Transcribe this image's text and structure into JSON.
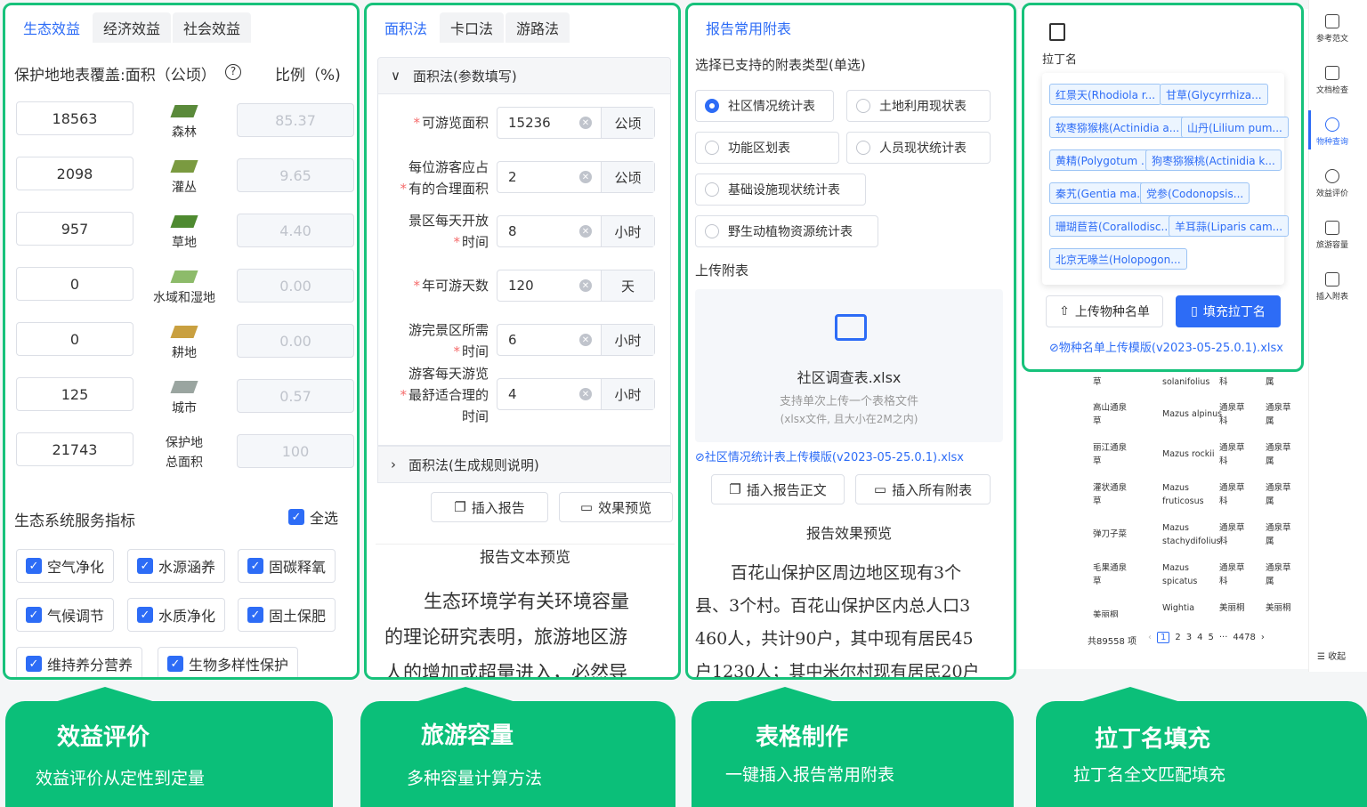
{
  "p1": {
    "tabs": [
      "生态效益",
      "经济效益",
      "社会效益"
    ],
    "header_label": "保护地地表覆盖:面积（公顷）",
    "ratio_label": "比例（%)",
    "rows": [
      {
        "area": "18563",
        "name": "森林",
        "ratio": "85.37"
      },
      {
        "area": "2098",
        "name": "灌丛",
        "ratio": "9.65"
      },
      {
        "area": "957",
        "name": "草地",
        "ratio": "4.40"
      },
      {
        "area": "0",
        "name": "水域和湿地",
        "ratio": "0.00"
      },
      {
        "area": "0",
        "name": "耕地",
        "ratio": "0.00"
      },
      {
        "area": "125",
        "name": "城市",
        "ratio": "0.57"
      }
    ],
    "total": {
      "area": "21743",
      "name_line1": "保护地",
      "name_line2": "总面积",
      "ratio": "100"
    },
    "services_title": "生态系统服务指标",
    "select_all": "全选",
    "services": [
      "空气净化",
      "水源涵养",
      "固碳释氧",
      "气候调节",
      "水质净化",
      "固土保肥",
      "维持养分营养",
      "生物多样性保护"
    ]
  },
  "p2": {
    "tabs": [
      "面积法",
      "卡口法",
      "游路法"
    ],
    "section1": "面积法(参数填写)",
    "fields": [
      {
        "l1": "可游览面积",
        "l2": "",
        "value": "15236",
        "unit": "公顷"
      },
      {
        "l1": "每位游客应占",
        "l2": "有的合理面积",
        "value": "2",
        "unit": "公顷"
      },
      {
        "l1": "景区每天开放",
        "l2": "时间",
        "value": "8",
        "unit": "小时"
      },
      {
        "l1": "年可游天数",
        "l2": "",
        "value": "120",
        "unit": "天"
      },
      {
        "l1": "游完景区所需",
        "l2": "时间",
        "value": "6",
        "unit": "小时"
      },
      {
        "l1": "游客每天游览",
        "l2": "最舒适合理的",
        "l3": "时间",
        "value": "4",
        "unit": "小时"
      }
    ],
    "section2": "面积法(生成规则说明)",
    "btn_insert": "插入报告",
    "btn_preview": "效果预览",
    "preview_title": "报告文本预览",
    "preview_text": [
      "生态环境学有关环境容量",
      "的理论研究表明，旅游地区游",
      "人的增加或超量进入，必然导"
    ]
  },
  "p3": {
    "tab": "报告常用附表",
    "select_label": "选择已支持的附表类型(单选)",
    "options": [
      "社区情况统计表",
      "土地利用现状表",
      "功能区划表",
      "人员现状统计表",
      "基础设施现状统计表",
      "野生动植物资源统计表"
    ],
    "upload_label": "上传附表",
    "file_name": "社区调查表.xlsx",
    "hint1": "支持单次上传一个表格文件",
    "hint2": "(xlsx文件, 且大小在2M之内)",
    "template_link": "社区情况统计表上传模版(v2023-05-25.0.1).xlsx",
    "btn_insert_body": "插入报告正文",
    "btn_insert_all": "插入所有附表",
    "preview_title": "报告效果预览",
    "preview_text": [
      "百花山保护区周边地区现有3个",
      "县、3个村。百花山保护区内总人口3",
      "460人，共计90户，其中现有居民45",
      "户1230人；其中米尔村现有居民20户"
    ]
  },
  "p4": {
    "title": "拉丁名",
    "tags": [
      "红景天(Rhodiola r...",
      "甘草(Glycyrrhiza...",
      "软枣猕猴桃(Actinidia a...",
      "山丹(Lilium pum...",
      "黄精(Polygotum ...",
      "狗枣猕猴桃(Actinidia k...",
      "秦艽(Gentia ma...",
      "党参(Codonopsis...",
      "珊瑚苣苔(Corallodisc...",
      "羊耳蒜(Liparis cam...",
      "北京无喙兰(Holopogon..."
    ],
    "btn_upload": "上传物种名单",
    "btn_fill": "填充拉丁名",
    "template_link": "物种名单上传模版(v2023-05-25.0.1).xlsx"
  },
  "table": {
    "partial_row": [
      "草",
      "solanifolius",
      "科",
      "属"
    ],
    "rows": [
      [
        "高山通泉草",
        "Mazus alpinus",
        "通泉草科",
        "通泉草属"
      ],
      [
        "丽江通泉草",
        "Mazus rockii",
        "通泉草科",
        "通泉草属"
      ],
      [
        "灌状通泉草",
        "Mazus fruticosus",
        "通泉草科",
        "通泉草属"
      ],
      [
        "弹刀子菜",
        "Mazus stachydifolius",
        "通泉草科",
        "通泉草属"
      ],
      [
        "毛果通泉草",
        "Mazus spicatus",
        "通泉草科",
        "通泉草属"
      ],
      [
        "美丽桐",
        "Wightia",
        "美丽桐",
        "美丽桐"
      ]
    ],
    "total": "共89558 项",
    "pages": [
      "1",
      "2",
      "3",
      "4",
      "5",
      "···",
      "4478"
    ]
  },
  "sidebar": [
    "参考范文",
    "文档检查",
    "物种查询",
    "效益评价",
    "旅游容量",
    "插入附表"
  ],
  "collapse": "收起",
  "cards": [
    {
      "title": "效益评价",
      "sub": "效益评价从定性到定量"
    },
    {
      "title": "旅游容量",
      "sub": "多种容量计算方法"
    },
    {
      "title": "表格制作",
      "sub": "一键插入报告常用附表"
    },
    {
      "title": "拉丁名填充",
      "sub": "拉丁名全文匹配填充"
    }
  ],
  "colors": {
    "accent": "#2d6cf6",
    "green": "#17c27b",
    "card": "#0bbf79"
  }
}
